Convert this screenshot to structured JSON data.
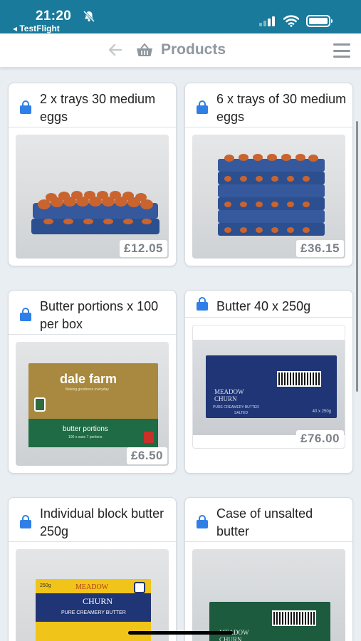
{
  "status_bar": {
    "time": "21:20",
    "back_app": "◂ TestFlight"
  },
  "nav": {
    "title": "Products"
  },
  "products": [
    {
      "name": "2 x trays 30 medium eggs",
      "price": "£12.05"
    },
    {
      "name": "6 x trays of 30 medium eggs",
      "price": "£36.15"
    },
    {
      "name": "Butter portions x 100 per box",
      "price": "£6.50",
      "photo_text": {
        "brand": "dale farm",
        "tagline": "Making goodness everyday",
        "product": "butter portions",
        "detail": "100 x sase 7 portions"
      }
    },
    {
      "name": "Butter 40 x 250g",
      "price": "£76.00",
      "photo_text": {
        "brand": "MEADOW CHURN",
        "sub": "PURE CREAMERY BUTTER",
        "sub2": "SALTED",
        "size": "40 x 250g"
      }
    },
    {
      "name": "Individual block butter 250g",
      "photo_text": {
        "weight": "250g",
        "brand1": "MEADOW",
        "brand2": "CHURN",
        "sub": "PURE CREAMERY BUTTER"
      }
    },
    {
      "name": "Case of unsalted butter",
      "photo_text": {
        "brand": "MEADOW CHURN"
      }
    }
  ],
  "colors": {
    "status_bar": "#1a7a9b",
    "accent_icon": "#2f7fe6",
    "price_text": "#7c8288"
  }
}
